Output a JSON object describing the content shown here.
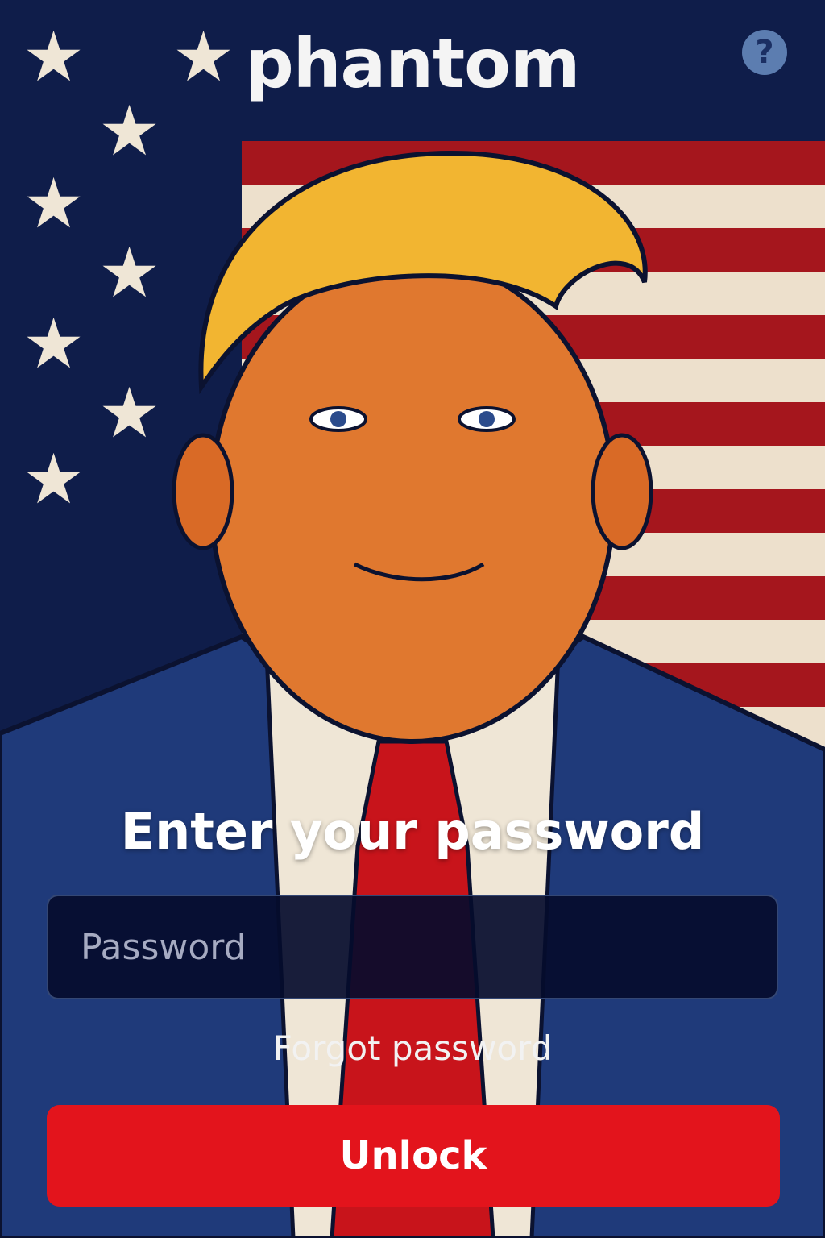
{
  "app": {
    "logo_text": "phantom"
  },
  "header": {
    "help_label": "?"
  },
  "lock_screen": {
    "heading": "Enter your password",
    "password_placeholder": "Password",
    "forgot_link": "Forgot password",
    "unlock_label": "Unlock"
  },
  "colors": {
    "flag_blue": "#0f1d4a",
    "flag_red": "#a5161d",
    "flag_white": "#ede0cc",
    "unlock_button": "#e3141c",
    "help_icon": "#5c7db0"
  },
  "icons": [
    "help-icon",
    "star-icon"
  ]
}
